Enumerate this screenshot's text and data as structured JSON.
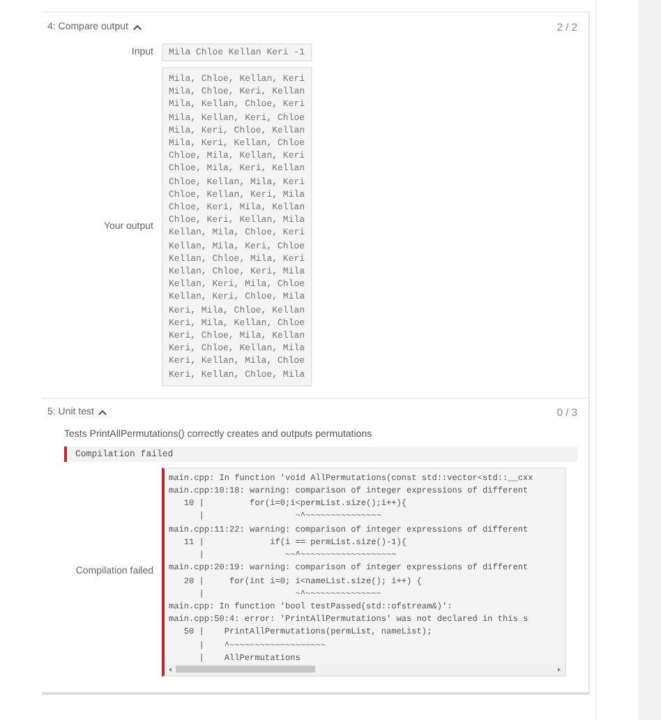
{
  "compare_output": {
    "title": "4: Compare output",
    "expanded": true,
    "score": "2 / 2",
    "input_label": "Input",
    "input_value": "Mila Chloe Kellan Keri -1",
    "output_label": "Your output",
    "output_lines": [
      "Mila, Chloe, Kellan, Keri",
      "Mila, Chloe, Keri, Kellan",
      "Mila, Kellan, Chloe, Keri",
      "Mila, Kellan, Keri, Chloe",
      "Mila, Keri, Chloe, Kellan",
      "Mila, Keri, Kellan, Chloe",
      "Chloe, Mila, Kellan, Keri",
      "Chloe, Mila, Keri, Kellan",
      "Chloe, Kellan, Mila, Keri",
      "Chloe, Kellan, Keri, Mila",
      "Chloe, Keri, Mila, Kellan",
      "Chloe, Keri, Kellan, Mila",
      "Kellan, Mila, Chloe, Keri",
      "Kellan, Mila, Keri, Chloe",
      "Kellan, Chloe, Mila, Keri",
      "Kellan, Chloe, Keri, Mila",
      "Kellan, Keri, Mila, Chloe",
      "Kellan, Keri, Chloe, Mila",
      "Keri, Mila, Chloe, Kellan",
      "Keri, Mila, Kellan, Chloe",
      "Keri, Chloe, Mila, Kellan",
      "Keri, Chloe, Kellan, Mila",
      "Keri, Kellan, Mila, Chloe",
      "Keri, Kellan, Chloe, Mila"
    ]
  },
  "unit_test": {
    "title": "5: Unit test",
    "expanded": true,
    "score": "0 / 3",
    "description": "Tests PrintAllPermutations() correctly creates and outputs permutations",
    "result": "Compilation failed",
    "output_label": "Compilation failed",
    "compiler_lines": [
      "main.cpp: In function 'void AllPermutations(const std::vector<std::__cxx",
      "main.cpp:10:18: warning: comparison of integer expressions of different",
      "   10 |         for(i=0;i<permList.size();i++){",
      "      |                  ~^~~~~~~~~~~~~~~~",
      "main.cpp:11:22: warning: comparison of integer expressions of different",
      "   11 |             if(i == permList.size()-1){",
      "      |                ~~^~~~~~~~~~~~~~~~~~~~",
      "main.cpp:20:19: warning: comparison of integer expressions of different",
      "   20 |     for(int i=0; i<nameList.size(); i++) {",
      "      |                  ~^~~~~~~~~~~~~~~~",
      "main.cpp: In function 'bool testPassed(std::ofstream&)':",
      "main.cpp:50:4: error: 'PrintAllPermutations' was not declared in this s",
      "   50 |    PrintAllPermutations(permList, nameList);",
      "      |    ^~~~~~~~~~~~~~~~~~~~",
      "      |    AllPermutations"
    ]
  }
}
